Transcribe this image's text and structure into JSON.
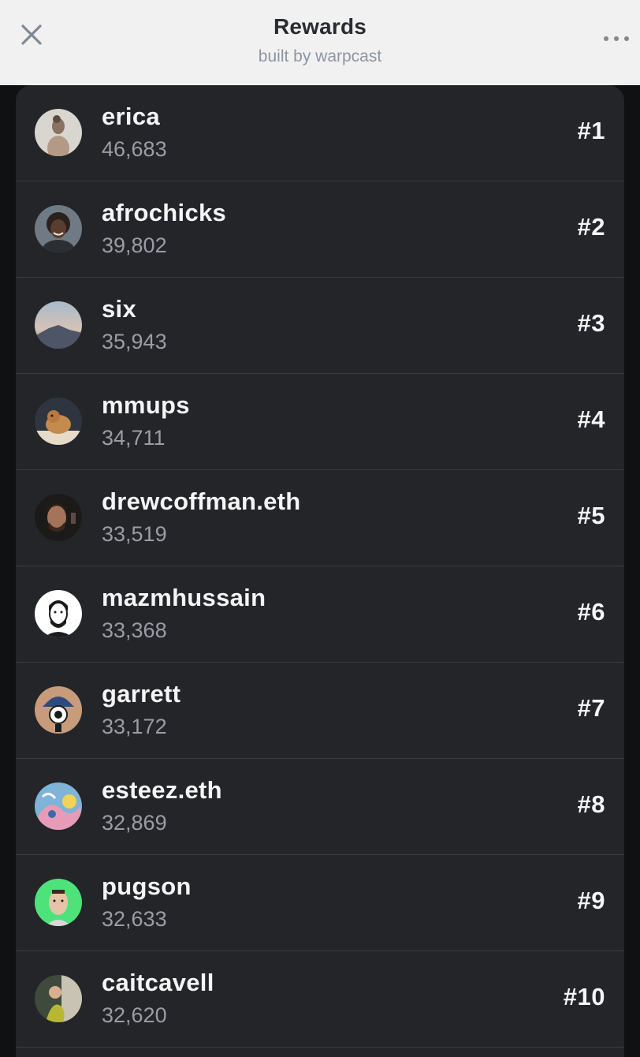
{
  "header": {
    "title": "Rewards",
    "subtitle": "built by warpcast"
  },
  "leaderboard": [
    {
      "name": "erica",
      "score": "46,683",
      "rank": "#1"
    },
    {
      "name": "afrochicks",
      "score": "39,802",
      "rank": "#2"
    },
    {
      "name": "six",
      "score": "35,943",
      "rank": "#3"
    },
    {
      "name": "mmups",
      "score": "34,711",
      "rank": "#4"
    },
    {
      "name": "drewcoffman.eth",
      "score": "33,519",
      "rank": "#5"
    },
    {
      "name": "mazmhussain",
      "score": "33,368",
      "rank": "#6"
    },
    {
      "name": "garrett",
      "score": "33,172",
      "rank": "#7"
    },
    {
      "name": "esteez.eth",
      "score": "32,869",
      "rank": "#8"
    },
    {
      "name": "pugson",
      "score": "32,633",
      "rank": "#9"
    },
    {
      "name": "caitcavell",
      "score": "32,620",
      "rank": "#10"
    }
  ],
  "colors": {
    "header_bg": "#f1f1f1",
    "list_bg": "#242528",
    "page_bg": "#101113",
    "text_primary": "#f5f5f7",
    "text_secondary": "#9a9da5"
  }
}
